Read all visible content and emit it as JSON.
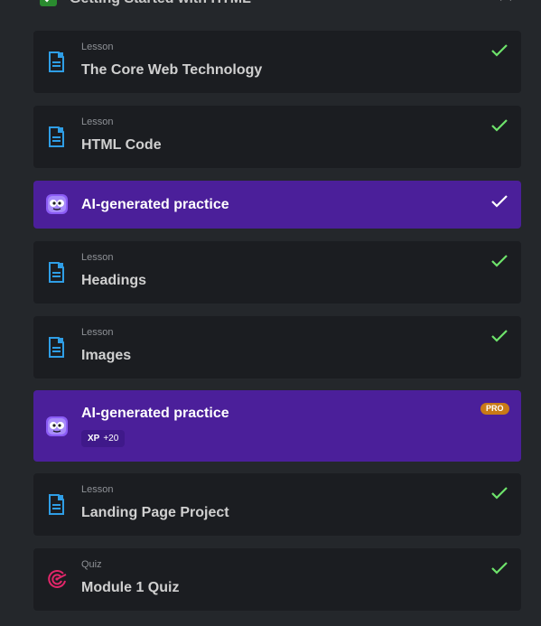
{
  "header": {
    "title": "Getting Started with HTML",
    "icon": "check-square-icon",
    "toggle_icon": "chevron-up-icon"
  },
  "colors": {
    "check": "#6ee36b",
    "ai_background": "#4b1f9a",
    "pro_badge": "#c97a16",
    "lesson_icon": "#2f9ee6",
    "quiz_icon": "#e2266a"
  },
  "items": [
    {
      "kind": "Lesson",
      "title": "The Core Web Technology",
      "icon": "lesson-icon",
      "completed": true
    },
    {
      "kind": "Lesson",
      "title": "HTML Code",
      "icon": "lesson-icon",
      "completed": true
    },
    {
      "kind": "",
      "title": "AI-generated practice",
      "icon": "ai-robot-icon",
      "completed": true
    },
    {
      "kind": "Lesson",
      "title": "Headings",
      "icon": "lesson-icon",
      "completed": true
    },
    {
      "kind": "Lesson",
      "title": "Images",
      "icon": "lesson-icon",
      "completed": true
    },
    {
      "kind": "",
      "title": "AI-generated practice",
      "icon": "ai-robot-icon",
      "completed": false,
      "badge": "PRO",
      "xp_label": "XP",
      "xp_value": "+20"
    },
    {
      "kind": "Lesson",
      "title": "Landing Page Project",
      "icon": "lesson-icon",
      "completed": true
    },
    {
      "kind": "Quiz",
      "title": "Module 1 Quiz",
      "icon": "quiz-target-icon",
      "completed": true
    }
  ]
}
